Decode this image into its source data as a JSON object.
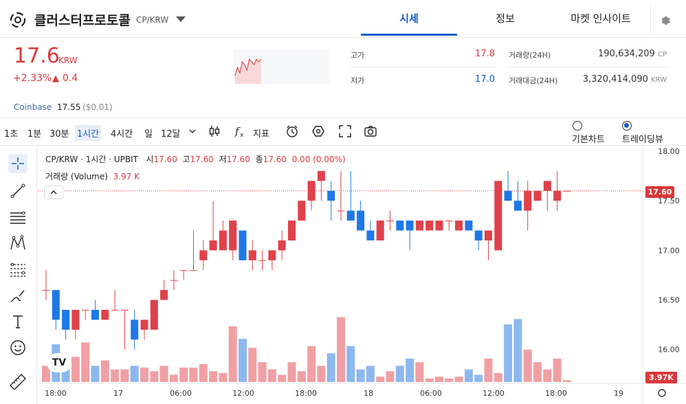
{
  "header": {
    "coin_name": "클러스터프로토콜",
    "pair": "CP/KRW",
    "tabs": [
      {
        "label": "시세",
        "active": true
      },
      {
        "label": "정보",
        "active": false
      },
      {
        "label": "마켓 인사이트",
        "active": false
      }
    ]
  },
  "ticker": {
    "price": "17.6",
    "unit": "KRW",
    "change_pct": "+2.33%",
    "change_arrow": "▲",
    "change_abs": "0.4",
    "mini_chart_values": [
      17.0,
      17.3,
      17.1,
      17.5,
      17.4,
      17.2,
      17.6,
      17.5,
      17.4,
      17.6,
      17.5,
      17.6
    ],
    "stats": {
      "high_label": "고가",
      "high": "17.8",
      "low_label": "저가",
      "low": "17.0",
      "volume_label": "거래량(24H)",
      "volume": "190,634,209",
      "volume_unit": "CP",
      "amount_label": "거래대금(24H)",
      "amount": "3,320,414,090",
      "amount_unit": "KRW"
    },
    "coinbase": {
      "label": "Coinbase",
      "price": "17.55",
      "usd": "($0.01)"
    }
  },
  "toolbar": {
    "intervals": [
      "1초",
      "1분",
      "30분",
      "1시간",
      "4시간",
      "일",
      "12달"
    ],
    "selected_interval": "1시간",
    "indicator_label": "지표",
    "view_options": [
      {
        "label": "기본차트",
        "selected": false
      },
      {
        "label": "트레이딩뷰",
        "selected": true
      }
    ]
  },
  "drawing_tools": [
    "crosshair-icon",
    "trend-line-icon",
    "horizontal-lines-icon",
    "pattern-icon",
    "fib-icon",
    "brush-icon",
    "text-icon",
    "emoji-icon",
    "ruler-icon"
  ],
  "chart_legend": {
    "symbol": "CP/KRW · 1시간 · UPBIT",
    "open_label": "시",
    "open": "17.60",
    "high_label": "고",
    "high": "17.60",
    "low_label": "저",
    "low": "17.60",
    "close_label": "종",
    "close": "17.60",
    "change": "0.00 (0.00%)",
    "volume_label": "거래량 (Volume)",
    "volume": "3.97 K",
    "last_price_badge": "17.60",
    "volume_badge": "3.97K",
    "tv_logo": "TV"
  },
  "colors": {
    "up": "#e0414a",
    "down": "#1e78e6",
    "up_vol": "#f0a0a4",
    "down_vol": "#8db8ef",
    "accent": "#115dcb"
  },
  "chart_data": {
    "type": "candlestick",
    "y_ticks": [
      "18.00",
      "17.50",
      "17.00",
      "16.50",
      "16.00"
    ],
    "ylim": [
      15.7,
      18.0
    ],
    "x_ticks": [
      "18:00",
      "17",
      "06:00",
      "12:00",
      "18:00",
      "18",
      "06:00",
      "12:00",
      "18:00",
      "19"
    ],
    "candles": [
      {
        "o": 16.6,
        "h": 16.8,
        "l": 16.5,
        "c": 16.6
      },
      {
        "o": 16.6,
        "h": 16.6,
        "l": 16.2,
        "c": 16.3
      },
      {
        "o": 16.4,
        "h": 16.4,
        "l": 16.1,
        "c": 16.2
      },
      {
        "o": 16.2,
        "h": 16.4,
        "l": 16.1,
        "c": 16.4
      },
      {
        "o": 16.4,
        "h": 16.4,
        "l": 16.3,
        "c": 16.4
      },
      {
        "o": 16.4,
        "h": 16.5,
        "l": 16.3,
        "c": 16.3
      },
      {
        "o": 16.3,
        "h": 16.4,
        "l": 16.3,
        "c": 16.4
      },
      {
        "o": 16.4,
        "h": 16.6,
        "l": 16.4,
        "c": 16.4
      },
      {
        "o": 16.4,
        "h": 16.4,
        "l": 16.0,
        "c": 16.4
      },
      {
        "o": 16.3,
        "h": 16.4,
        "l": 16.0,
        "c": 16.1
      },
      {
        "o": 16.2,
        "h": 16.3,
        "l": 16.1,
        "c": 16.3
      },
      {
        "o": 16.2,
        "h": 16.5,
        "l": 16.2,
        "c": 16.5
      },
      {
        "o": 16.5,
        "h": 16.7,
        "l": 16.5,
        "c": 16.6
      },
      {
        "o": 16.7,
        "h": 16.8,
        "l": 16.6,
        "c": 16.7
      },
      {
        "o": 16.8,
        "h": 16.8,
        "l": 16.7,
        "c": 16.8
      },
      {
        "o": 16.8,
        "h": 17.2,
        "l": 16.8,
        "c": 16.8
      },
      {
        "o": 16.9,
        "h": 17.1,
        "l": 16.8,
        "c": 17.0
      },
      {
        "o": 17.0,
        "h": 17.5,
        "l": 17.0,
        "c": 17.1
      },
      {
        "o": 17.0,
        "h": 17.3,
        "l": 17.0,
        "c": 17.2
      },
      {
        "o": 17.0,
        "h": 17.3,
        "l": 16.9,
        "c": 17.3
      },
      {
        "o": 17.2,
        "h": 17.2,
        "l": 16.9,
        "c": 16.9
      },
      {
        "o": 16.9,
        "h": 17.1,
        "l": 16.8,
        "c": 17.0
      },
      {
        "o": 16.9,
        "h": 17.0,
        "l": 16.8,
        "c": 16.9
      },
      {
        "o": 16.9,
        "h": 17.0,
        "l": 16.8,
        "c": 17.0
      },
      {
        "o": 17.0,
        "h": 17.2,
        "l": 16.9,
        "c": 17.1
      },
      {
        "o": 17.1,
        "h": 17.3,
        "l": 17.1,
        "c": 17.3
      },
      {
        "o": 17.3,
        "h": 17.5,
        "l": 17.3,
        "c": 17.5
      },
      {
        "o": 17.5,
        "h": 17.7,
        "l": 17.4,
        "c": 17.7
      },
      {
        "o": 17.7,
        "h": 17.7,
        "l": 17.5,
        "c": 17.8
      },
      {
        "o": 17.6,
        "h": 17.7,
        "l": 17.3,
        "c": 17.5
      },
      {
        "o": 17.4,
        "h": 17.8,
        "l": 17.3,
        "c": 17.4
      },
      {
        "o": 17.4,
        "h": 17.8,
        "l": 17.3,
        "c": 17.3
      },
      {
        "o": 17.4,
        "h": 17.5,
        "l": 17.2,
        "c": 17.2
      },
      {
        "o": 17.2,
        "h": 17.3,
        "l": 17.1,
        "c": 17.1
      },
      {
        "o": 17.1,
        "h": 17.3,
        "l": 17.1,
        "c": 17.3
      },
      {
        "o": 17.3,
        "h": 17.4,
        "l": 17.2,
        "c": 17.3
      },
      {
        "o": 17.3,
        "h": 17.3,
        "l": 17.2,
        "c": 17.2
      },
      {
        "o": 17.3,
        "h": 17.3,
        "l": 17.0,
        "c": 17.2
      },
      {
        "o": 17.2,
        "h": 17.3,
        "l": 17.2,
        "c": 17.3
      },
      {
        "o": 17.2,
        "h": 17.3,
        "l": 17.2,
        "c": 17.3
      },
      {
        "o": 17.2,
        "h": 17.3,
        "l": 17.2,
        "c": 17.3
      },
      {
        "o": 17.3,
        "h": 17.3,
        "l": 17.2,
        "c": 17.3
      },
      {
        "o": 17.2,
        "h": 17.3,
        "l": 17.2,
        "c": 17.3
      },
      {
        "o": 17.3,
        "h": 17.3,
        "l": 17.2,
        "c": 17.2
      },
      {
        "o": 17.2,
        "h": 17.2,
        "l": 17.0,
        "c": 17.1
      },
      {
        "o": 17.1,
        "h": 17.2,
        "l": 16.9,
        "c": 17.2
      },
      {
        "o": 17.0,
        "h": 17.7,
        "l": 17.0,
        "c": 17.7
      },
      {
        "o": 17.6,
        "h": 17.8,
        "l": 17.5,
        "c": 17.5
      },
      {
        "o": 17.5,
        "h": 17.7,
        "l": 17.4,
        "c": 17.4
      },
      {
        "o": 17.4,
        "h": 17.7,
        "l": 17.2,
        "c": 17.6
      },
      {
        "o": 17.5,
        "h": 17.6,
        "l": 17.5,
        "c": 17.6
      },
      {
        "o": 17.6,
        "h": 17.7,
        "l": 17.4,
        "c": 17.7
      },
      {
        "o": 17.5,
        "h": 17.8,
        "l": 17.4,
        "c": 17.6
      },
      {
        "o": 17.6,
        "h": 17.6,
        "l": 17.6,
        "c": 17.6
      }
    ],
    "volumes": [
      0.9,
      2.1,
      1.3,
      1.4,
      2.2,
      0.9,
      1.2,
      0.7,
      0.7,
      0.9,
      0.8,
      0.6,
      0.9,
      0.4,
      0.8,
      0.8,
      1.0,
      0.6,
      0.5,
      3.1,
      2.4,
      1.9,
      1.1,
      0.7,
      0.4,
      1.1,
      0.6,
      2.0,
      0.9,
      1.6,
      3.6,
      2.0,
      0.7,
      0.9,
      0.3,
      0.6,
      0.9,
      1.3,
      1.1,
      0.2,
      0.3,
      0.2,
      0.3,
      0.7,
      0.4,
      1.3,
      0.5,
      3.2,
      3.5,
      1.8,
      1.1,
      0.7,
      1.3,
      0.1
    ],
    "title": "",
    "xlabel": "",
    "ylabel": "",
    "grid": false,
    "legend_position": "top-left"
  }
}
